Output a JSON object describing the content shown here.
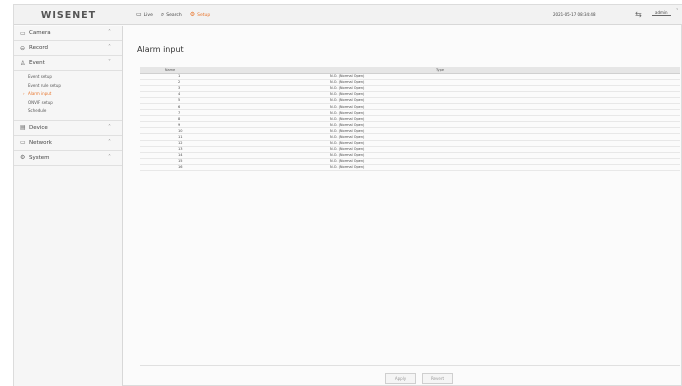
{
  "topbar": {
    "logo": "WISENET",
    "nav": [
      {
        "label": "Live",
        "icon": "monitor-icon"
      },
      {
        "label": "Search",
        "icon": "search-icon"
      },
      {
        "label": "Setup",
        "icon": "setup-icon",
        "active": true
      }
    ],
    "datetime": "2021-05-17 08:34:48",
    "user": "admin"
  },
  "sidebar": {
    "menus": [
      {
        "label": "Camera"
      },
      {
        "label": "Record"
      },
      {
        "label": "Event",
        "submenu": [
          "Event setup",
          "Event rule setup",
          "Alarm input",
          "ONVIF setup",
          "Schedule"
        ]
      },
      {
        "label": "Device"
      },
      {
        "label": "Network"
      },
      {
        "label": "System"
      }
    ]
  },
  "main": {
    "title": "Alarm input",
    "table": {
      "headers": [
        "Name",
        "Type"
      ],
      "rows": [
        [
          "1",
          "N.O. (Normal Open)"
        ],
        [
          "2",
          "N.O. (Normal Open)"
        ],
        [
          "3",
          "N.O. (Normal Open)"
        ],
        [
          "4",
          "N.O. (Normal Open)"
        ],
        [
          "5",
          "N.O. (Normal Open)"
        ],
        [
          "6",
          "N.O. (Normal Open)"
        ],
        [
          "7",
          "N.O. (Normal Open)"
        ],
        [
          "8",
          "N.O. (Normal Open)"
        ],
        [
          "9",
          "N.O. (Normal Open)"
        ],
        [
          "10",
          "N.O. (Normal Open)"
        ],
        [
          "11",
          "N.O. (Normal Open)"
        ],
        [
          "12",
          "N.O. (Normal Open)"
        ],
        [
          "13",
          "N.O. (Normal Open)"
        ],
        [
          "14",
          "N.O. (Normal Open)"
        ],
        [
          "15",
          "N.O. (Normal Open)"
        ],
        [
          "16",
          "N.O. (Normal Open)"
        ]
      ]
    },
    "buttons": {
      "apply": "Apply",
      "revert": "Revert"
    }
  },
  "colors": {
    "accent": "#e8742a"
  }
}
